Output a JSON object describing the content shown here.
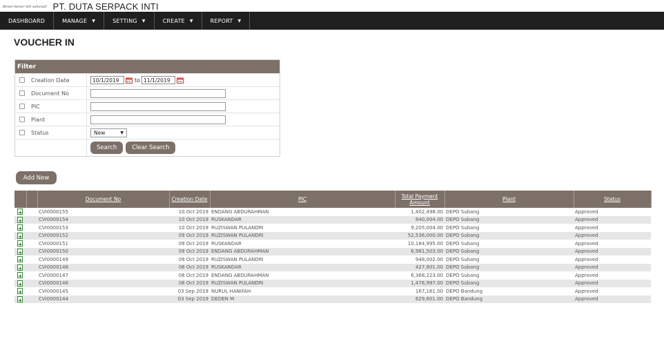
{
  "header": {
    "tagline": "Bener-bener teh sehenal!",
    "company": "PT. DUTA SERPACK INTI"
  },
  "nav": [
    {
      "label": "DASHBOARD",
      "dropdown": false
    },
    {
      "label": "MANAGE",
      "dropdown": true
    },
    {
      "label": "SETTING",
      "dropdown": true
    },
    {
      "label": "CREATE",
      "dropdown": true
    },
    {
      "label": "REPORT",
      "dropdown": true
    }
  ],
  "page_title": "VOUCHER IN",
  "filter": {
    "title": "Filter",
    "creation_date": {
      "label": "Creation Date",
      "from": "10/1/2019",
      "to_label": "to",
      "to": "11/1/2019"
    },
    "document_no": {
      "label": "Document No",
      "value": ""
    },
    "pic": {
      "label": "PIC",
      "value": ""
    },
    "plant": {
      "label": "Plant",
      "value": ""
    },
    "status": {
      "label": "Status",
      "value": "New"
    },
    "search_label": "Search",
    "clear_label": "Clear Search"
  },
  "add_new_label": "Add New",
  "colors": {
    "header_bg": "#7d7068",
    "nav_bg": "#1f1f1f",
    "icon_green": "#2e8b2e"
  },
  "table": {
    "columns": {
      "document_no": "Document No",
      "creation_date": "Creation Date",
      "pic": "PIC",
      "total_payment": "Total Payment Amount",
      "plant": "Plant",
      "status": "Status"
    },
    "rows": [
      {
        "doc": "CVI0000155",
        "date": "10 Oct 2019",
        "pic": "ENDANG ABDURAHMAN",
        "amount": "1,402,498.00",
        "plant": "DEPO Subang",
        "status": "Approved"
      },
      {
        "doc": "CVI0000154",
        "date": "10 Oct 2019",
        "pic": "RUSKANDAR",
        "amount": "840,004.00",
        "plant": "DEPO Subang",
        "status": "Approved"
      },
      {
        "doc": "CVI0000153",
        "date": "10 Oct 2019",
        "pic": "RUZISWAN PULANDRI",
        "amount": "9,205,004.00",
        "plant": "DEPO Subang",
        "status": "Approved"
      },
      {
        "doc": "CVI0000152",
        "date": "09 Oct 2019",
        "pic": "RUZISWAN PULANDRI",
        "amount": "52,536,000.00",
        "plant": "DEPO Subang",
        "status": "Approved"
      },
      {
        "doc": "CVI0000151",
        "date": "09 Oct 2019",
        "pic": "RUSKANDAR",
        "amount": "10,184,995.00",
        "plant": "DEPO Subang",
        "status": "Approved"
      },
      {
        "doc": "CVI0000150",
        "date": "09 Oct 2019",
        "pic": "ENDANG ABDURAHMAN",
        "amount": "6,981,503.00",
        "plant": "DEPO Subang",
        "status": "Approved"
      },
      {
        "doc": "CVI0000149",
        "date": "09 Oct 2019",
        "pic": "RUZISWAN PULANDRI",
        "amount": "948,002.00",
        "plant": "DEPO Subang",
        "status": "Approved"
      },
      {
        "doc": "CVI0000148",
        "date": "08 Oct 2019",
        "pic": "RUSKANDAR",
        "amount": "427,801.00",
        "plant": "DEPO Subang",
        "status": "Approved"
      },
      {
        "doc": "CVI0000147",
        "date": "08 Oct 2019",
        "pic": "ENDANG ABDURAHMAN",
        "amount": "6,368,223.00",
        "plant": "DEPO Subang",
        "status": "Approved"
      },
      {
        "doc": "CVI0000146",
        "date": "08 Oct 2019",
        "pic": "RUZISWAN PULANDRI",
        "amount": "1,476,997.00",
        "plant": "DEPO Subang",
        "status": "Approved"
      },
      {
        "doc": "CVI0000145",
        "date": "03 Sep 2019",
        "pic": "NURUL HANIFAH",
        "amount": "167,161.00",
        "plant": "DEPO Bandung",
        "status": "Approved"
      },
      {
        "doc": "CVI0000144",
        "date": "03 Sep 2019",
        "pic": "DEDEN M",
        "amount": "629,601.00",
        "plant": "DEPO Bandung",
        "status": "Approved"
      }
    ]
  }
}
